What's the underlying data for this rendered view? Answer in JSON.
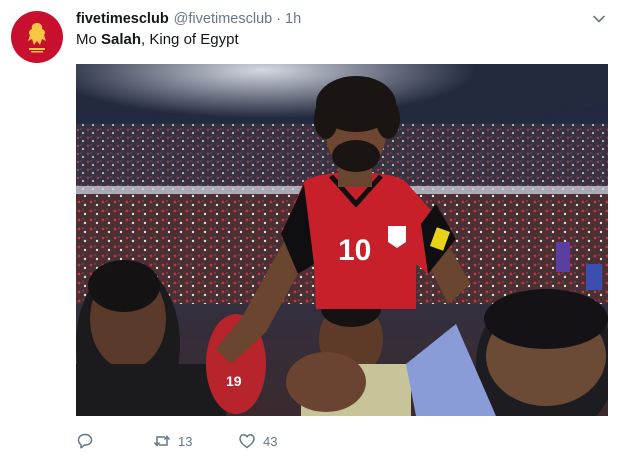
{
  "tweet": {
    "display_name": "fivetimesclub",
    "handle": "@fivetimesclub",
    "separator": "·",
    "time": "1h",
    "text_before": "Mo ",
    "text_bold": "Salah",
    "text_after": ", King of Egypt",
    "jersey_number": "10",
    "retweet_count": "13",
    "like_count": "43"
  },
  "icons": {
    "avatar": "liverbird-logo",
    "menu": "chevron-down-icon",
    "reply": "reply-icon",
    "retweet": "retweet-icon",
    "like": "heart-icon"
  },
  "colors": {
    "brand_red": "#c8102e",
    "text": "#14171a",
    "secondary": "#657786"
  }
}
